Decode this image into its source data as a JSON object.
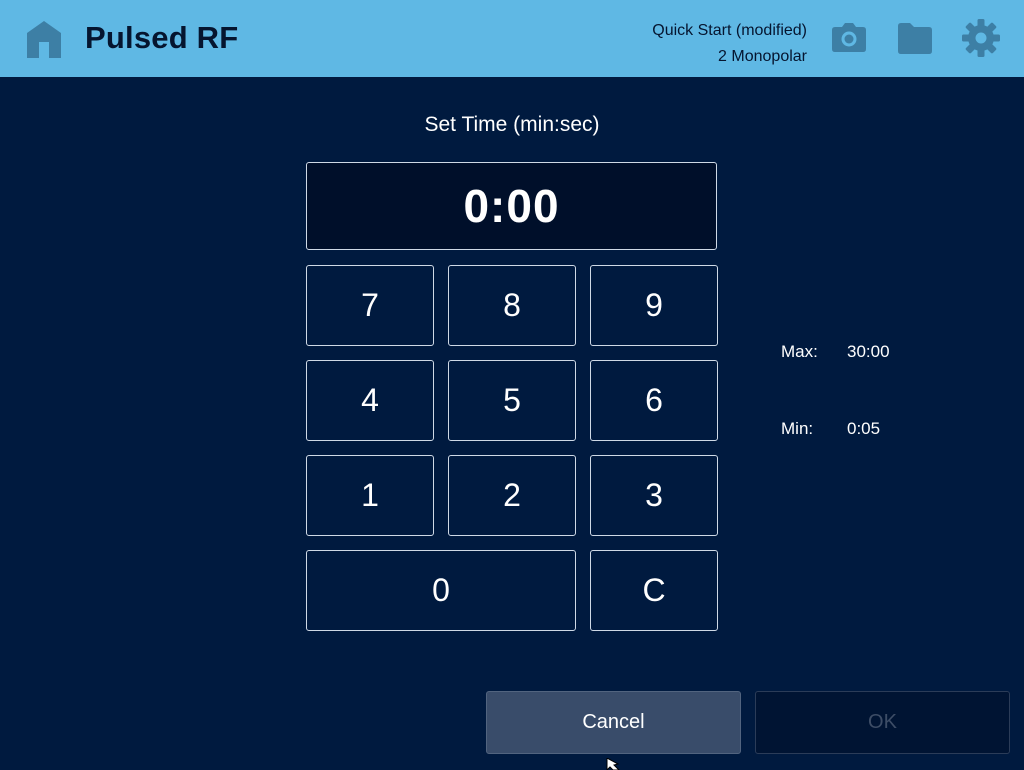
{
  "header": {
    "title": "Pulsed RF",
    "preset_name": "Quick Start (modified)",
    "preset_mode": "2 Monopolar",
    "icons": [
      "home-icon",
      "camera-icon",
      "folder-icon",
      "gear-icon"
    ],
    "background_color": "#5fb8e4"
  },
  "dialog": {
    "label": "Set Time (min:sec)",
    "display_value": "0:00",
    "keys": [
      "7",
      "8",
      "9",
      "4",
      "5",
      "6",
      "1",
      "2",
      "3",
      "0",
      "C"
    ],
    "max_label": "Max:",
    "max_value": "30:00",
    "min_label": "Min:",
    "min_value": "0:05"
  },
  "actions": {
    "cancel_label": "Cancel",
    "ok_label": "OK"
  },
  "colors": {
    "background": "#001a3f",
    "cancel_button": "#394c6a",
    "ok_button_disabled": "#001433"
  }
}
